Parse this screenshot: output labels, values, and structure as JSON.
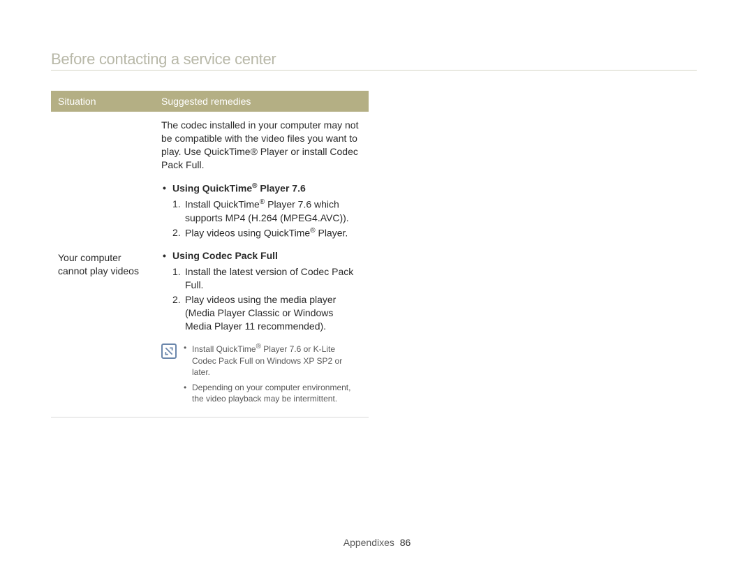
{
  "page": {
    "title": "Before contacting a service center"
  },
  "table": {
    "headers": {
      "left": "Situation",
      "right": "Suggested remedies"
    },
    "row": {
      "situation": "Your computer cannot play videos",
      "intro": "The codec installed in your computer may not be compatible with the video files you want to play. Use QuickTime® Player or install Codec Pack Full.",
      "section1": {
        "heading_prefix": "Using QuickTime",
        "heading_suffix": " Player 7.6",
        "steps": [
          {
            "num": "1.",
            "text_prefix": "Install QuickTime",
            "text_suffix": " Player 7.6 which supports MP4 (H.264 (MPEG4.AVC))."
          },
          {
            "num": "2.",
            "text_prefix": "Play videos using QuickTime",
            "text_suffix": " Player."
          }
        ]
      },
      "section2": {
        "heading": "Using Codec Pack Full",
        "steps": [
          {
            "num": "1.",
            "text": "Install the latest version of Codec Pack Full."
          },
          {
            "num": "2.",
            "text": "Play videos using the media player (Media Player Classic or Windows Media Player 11 recommended)."
          }
        ]
      },
      "notes": [
        {
          "prefix": "Install QuickTime",
          "suffix": " Player 7.6 or K-Lite Codec Pack Full on Windows XP SP2 or later."
        },
        {
          "text": "Depending on your computer environment, the video playback may be intermittent."
        }
      ]
    }
  },
  "footer": {
    "section": "Appendixes",
    "page": "86"
  },
  "symbols": {
    "bullet": "•",
    "reg": "®"
  }
}
